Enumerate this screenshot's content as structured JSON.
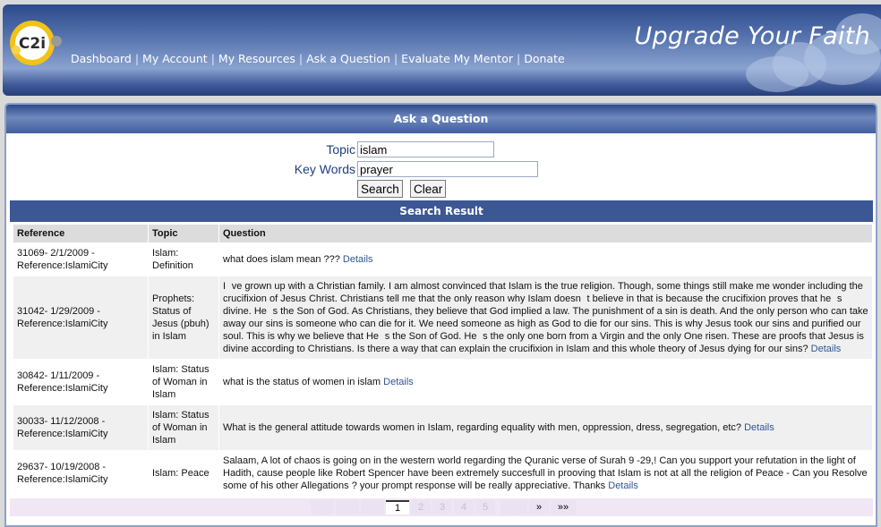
{
  "header": {
    "logo_text": "C2i",
    "tagline": "Upgrade Your Faith",
    "nav": [
      "Dashboard",
      "My Account",
      "My Resources",
      "Ask a Question",
      "Evaluate My Mentor",
      "Donate"
    ],
    "separator": "|"
  },
  "panel": {
    "title": "Ask a Question",
    "form": {
      "topic_label": "Topic",
      "topic_value": "islam",
      "keywords_label": "Key Words",
      "keywords_value": "prayer",
      "search_button": "Search",
      "clear_button": "Clear"
    },
    "results_title": "Search Result",
    "columns": [
      "Reference",
      "Topic",
      "Question"
    ],
    "details_label": "Details",
    "rows": [
      {
        "reference": "31069- 2/1/2009 - Reference:IslamiCity",
        "topic": "Islam: Definition",
        "question": "what does islam mean ???"
      },
      {
        "reference": "31042- 1/29/2009 - Reference:IslamiCity",
        "topic": "Prophets: Status of Jesus (pbuh) in Islam",
        "question": "Ive grown up with a Christian family. I am almost convinced that Islam is the true religion. Though, some things still make me wonder including the crucifixion of Jesus Christ. Christians tell me that the only reason why Islam doesnt believe in that is because the crucifixion proves that hes divine. Hes the Son of God. As Christians, they believe that God implied a law. The punishment of a sin is death. And the only person who can take away our sins is someone who can die for it. We need someone as high as God to die for our sins. This is why Jesus took our sins and purified our soul. This is why we believe that Hes the Son of God. Hes the only one born from a Virgin and the only One risen. These are proofs that Jesus is divine according to Christians. Is there a way that can explain the crucifixion in Islam and this whole theory of Jesus dying for our sins?"
      },
      {
        "reference": "30842- 1/11/2009 - Reference:IslamiCity",
        "topic": "Islam: Status of Woman in Islam",
        "question": "what is the status of women in islam"
      },
      {
        "reference": "30033- 11/12/2008 - Reference:IslamiCity",
        "topic": "Islam: Status of Woman in Islam",
        "question": "What is the general attitude towards women in Islam, regarding equality with men, oppression, dress, segregation, etc?"
      },
      {
        "reference": "29637- 10/19/2008 - Reference:IslamiCity",
        "topic": "Islam: Peace",
        "question": "Salaam, A lot of chaos is going on in the western world regarding the Quranic verse of Surah 9 -29,! Can you support your refutation in the light of Hadith, cause people like Robert Spencer have been extremely succesfull in prooving that Islam is not at all the religion of Peace - Can you Resolve some of his other Allegations ? your prompt response will be really appreciative. Thanks"
      }
    ],
    "pager": {
      "pages": [
        "1",
        "2",
        "3",
        "4",
        "5"
      ],
      "current": "1",
      "next": "»",
      "last": "»»"
    }
  },
  "colors": {
    "header_blue": "#2c4a8c",
    "result_bar": "#3b5794",
    "link": "#2f5593",
    "label": "#1f3d7a",
    "logo_yellow": "#f2c21a"
  }
}
